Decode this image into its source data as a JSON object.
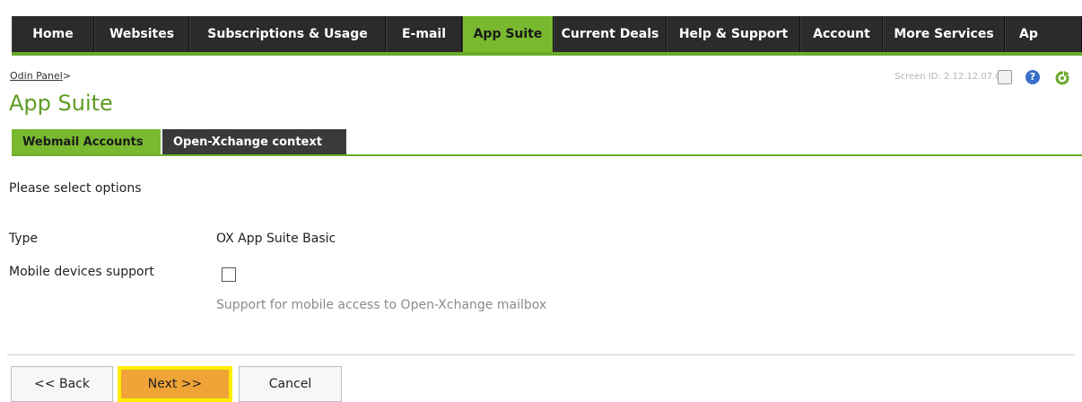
{
  "nav": {
    "items": [
      {
        "label": "Home",
        "active": false
      },
      {
        "label": "Websites",
        "active": false
      },
      {
        "label": "Subscriptions & Usage",
        "active": false
      },
      {
        "label": "E-mail",
        "active": false
      },
      {
        "label": "App Suite",
        "active": true
      },
      {
        "label": "Current Deals",
        "active": false
      },
      {
        "label": "Help & Support",
        "active": false
      },
      {
        "label": "Account",
        "active": false
      },
      {
        "label": "More Services",
        "active": false
      },
      {
        "label": "Ap",
        "active": false
      }
    ]
  },
  "header": {
    "breadcrumb_link": "Odin Panel",
    "breadcrumb_sep": ">",
    "title": "App Suite",
    "screen_id": "Screen ID:  2.12.12.07.02",
    "help_glyph": "?"
  },
  "tabs": [
    {
      "label": "Webmail Accounts",
      "active": true
    },
    {
      "label": "Open-Xchange context",
      "active": false
    }
  ],
  "form": {
    "intro": "Please select options",
    "type_label": "Type",
    "type_value": "OX App Suite Basic",
    "mobile_label": "Mobile devices support",
    "mobile_checked": false,
    "mobile_hint": "Support for mobile access to Open-Xchange mailbox"
  },
  "buttons": {
    "back": "<< Back",
    "next": "Next >>",
    "cancel": "Cancel"
  },
  "colors": {
    "accent_green": "#78b930",
    "title_green": "#5f9c25",
    "nav_dark": "#2b2b2b",
    "next_orange": "#f0a336",
    "highlight_yellow": "#ffee00"
  },
  "icons": {
    "header": [
      "document-icon",
      "help-icon",
      "refresh-icon"
    ]
  }
}
